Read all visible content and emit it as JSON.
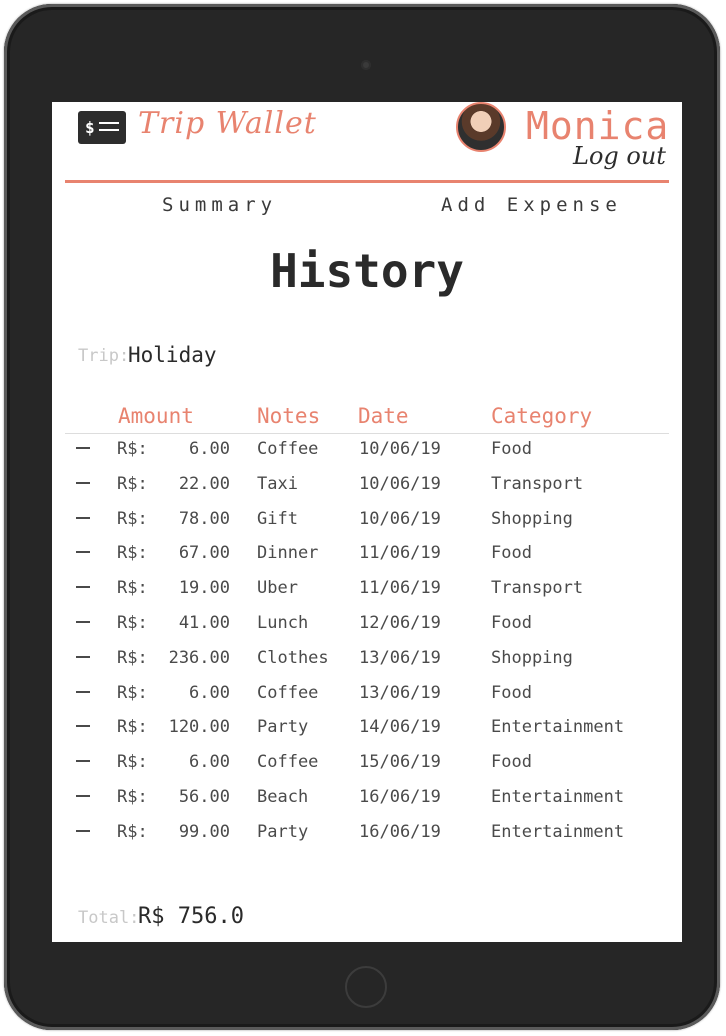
{
  "header": {
    "logo_text": "$",
    "brand": "Trip Wallet",
    "user_name": "Monica",
    "logout_label": "Log out"
  },
  "nav": {
    "summary_label": "Summary",
    "add_expense_label": "Add Expense"
  },
  "page": {
    "title": "History"
  },
  "trip": {
    "label": "Trip:",
    "value": "Holiday"
  },
  "table": {
    "headers": {
      "amount": "Amount",
      "notes": "Notes",
      "date": "Date",
      "category": "Category"
    },
    "currency": "R$:",
    "rows": [
      {
        "amount": "6.00",
        "notes": "Coffee",
        "date": "10/06/19",
        "category": "Food"
      },
      {
        "amount": "22.00",
        "notes": "Taxi",
        "date": "10/06/19",
        "category": "Transport"
      },
      {
        "amount": "78.00",
        "notes": "Gift",
        "date": "10/06/19",
        "category": "Shopping"
      },
      {
        "amount": "67.00",
        "notes": "Dinner",
        "date": "11/06/19",
        "category": "Food"
      },
      {
        "amount": "19.00",
        "notes": "Uber",
        "date": "11/06/19",
        "category": "Transport"
      },
      {
        "amount": "41.00",
        "notes": "Lunch",
        "date": "12/06/19",
        "category": "Food"
      },
      {
        "amount": "236.00",
        "notes": "Clothes",
        "date": "13/06/19",
        "category": "Shopping"
      },
      {
        "amount": "6.00",
        "notes": "Coffee",
        "date": "13/06/19",
        "category": "Food"
      },
      {
        "amount": "120.00",
        "notes": "Party",
        "date": "14/06/19",
        "category": "Entertainment"
      },
      {
        "amount": "6.00",
        "notes": "Coffee",
        "date": "15/06/19",
        "category": "Food"
      },
      {
        "amount": "56.00",
        "notes": "Beach",
        "date": "16/06/19",
        "category": "Entertainment"
      },
      {
        "amount": "99.00",
        "notes": "Party",
        "date": "16/06/19",
        "category": "Entertainment"
      }
    ]
  },
  "total": {
    "label": "Total:",
    "value": "R$ 756.0"
  },
  "colors": {
    "accent": "#e8836f",
    "text": "#2a2a2a",
    "muted": "#c8c8c8",
    "frame": "#262626"
  }
}
